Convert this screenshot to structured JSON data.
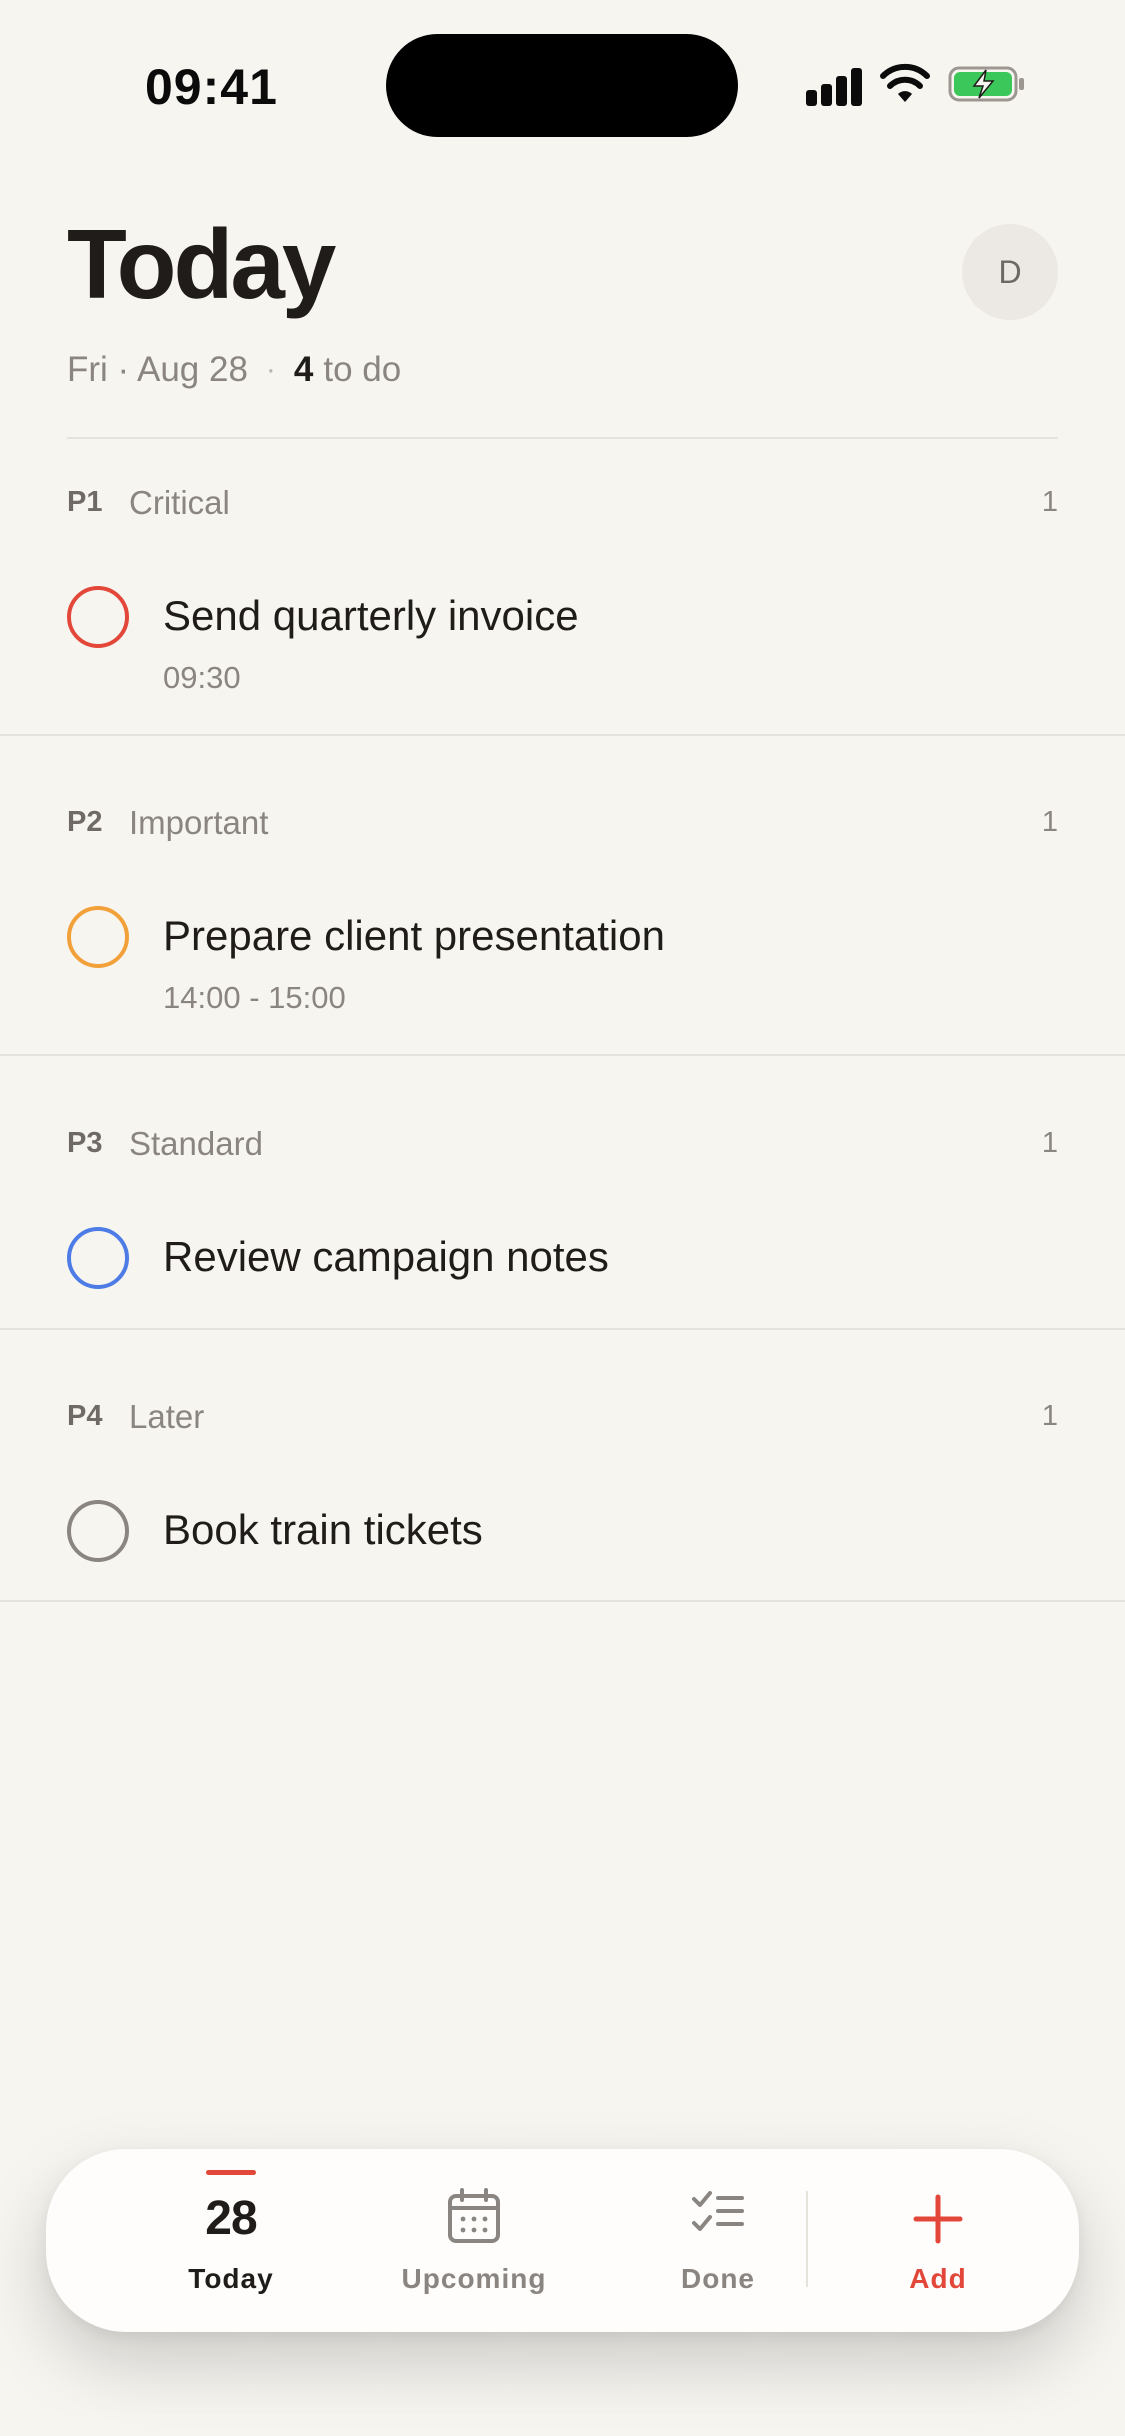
{
  "status_bar": {
    "time": "09:41"
  },
  "header": {
    "title": "Today",
    "avatar_initial": "D",
    "date": "Fri · Aug 28",
    "separator": "·",
    "todo_count": "4",
    "todo_suffix": "to do"
  },
  "sections": [
    {
      "code": "P1",
      "name": "Critical",
      "count": "1",
      "color": "#e2473a",
      "tasks": [
        {
          "title": "Send quarterly invoice",
          "time": "09:30"
        }
      ]
    },
    {
      "code": "P2",
      "name": "Important",
      "count": "1",
      "color": "#f2a13a",
      "tasks": [
        {
          "title": "Prepare client presentation",
          "time": "14:00 - 15:00"
        }
      ]
    },
    {
      "code": "P3",
      "name": "Standard",
      "count": "1",
      "color": "#4d7ce6",
      "tasks": [
        {
          "title": "Review campaign notes"
        }
      ]
    },
    {
      "code": "P4",
      "name": "Later",
      "count": "1",
      "color": "#8a8580",
      "tasks": [
        {
          "title": "Book train tickets"
        }
      ]
    }
  ],
  "nav": {
    "today_number": "28",
    "items": [
      {
        "label": "Today",
        "icon": "today-date-icon",
        "active": true
      },
      {
        "label": "Upcoming",
        "icon": "calendar-icon"
      },
      {
        "label": "Done",
        "icon": "checklist-icon"
      },
      {
        "label": "Add",
        "icon": "plus-icon"
      }
    ],
    "accent_color": "#e2473a"
  }
}
